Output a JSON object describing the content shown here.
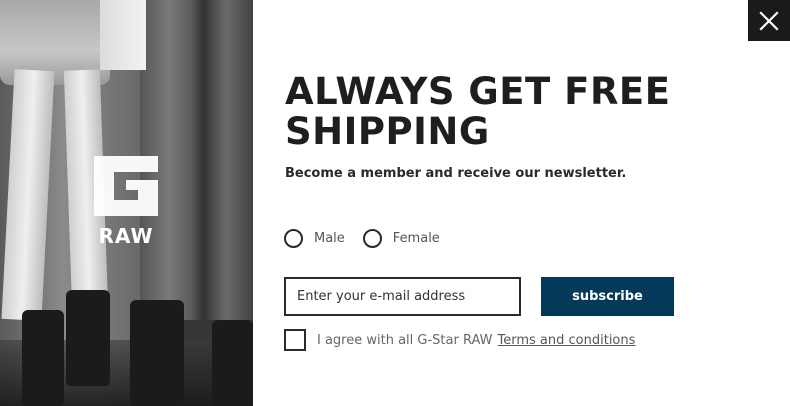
{
  "photo": {
    "logo_text": "RAW"
  },
  "close": {
    "label": "×"
  },
  "popup": {
    "headline": "ALWAYS GET FREE SHIPPING",
    "subheadline": "Become a member and receive our newsletter.",
    "gender_options": [
      "Male",
      "Female"
    ],
    "email_placeholder": "Enter your e-mail address",
    "email_value": "",
    "subscribe_label": "subscribe",
    "agree_text": "I agree with all G-Star RAW",
    "terms_link": "Terms and conditions"
  },
  "colors": {
    "accent": "#05395a",
    "close_bg": "#1a1a1a",
    "headline": "#1e1e1e"
  }
}
